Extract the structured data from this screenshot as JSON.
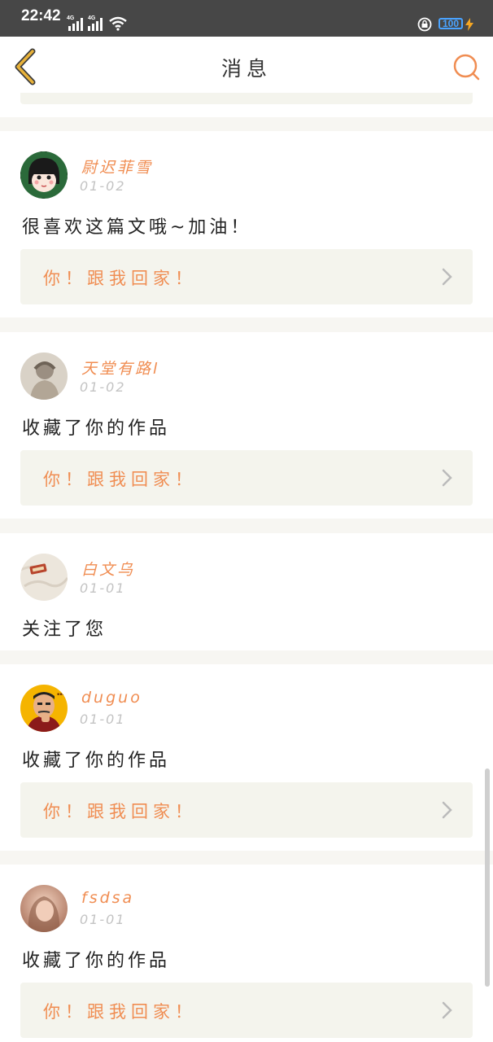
{
  "status_bar": {
    "time": "22:42",
    "signal1": "4G",
    "signal2": "4G",
    "battery": "100"
  },
  "header": {
    "title": "消息"
  },
  "colors": {
    "accent": "#f08d52",
    "back_arrow": "#e8b23a",
    "reply_bg": "#f4f4ed"
  },
  "messages": [
    {
      "user": "尉迟菲雪",
      "date": "01-02",
      "text": "很喜欢这篇文哦~加油！",
      "reply": "你！跟我回家！"
    },
    {
      "user": "天堂有路l",
      "date": "01-02",
      "text": "收藏了你的作品",
      "reply": "你！跟我回家！"
    },
    {
      "user": "白文乌",
      "date": "01-01",
      "text": "关注了您"
    },
    {
      "user": "duguo",
      "date": "01-01",
      "text": "收藏了你的作品",
      "reply": "你！跟我回家！"
    },
    {
      "user": "fsdsa",
      "date": "01-01",
      "text": "收藏了你的作品",
      "reply": "你！跟我回家！"
    }
  ]
}
